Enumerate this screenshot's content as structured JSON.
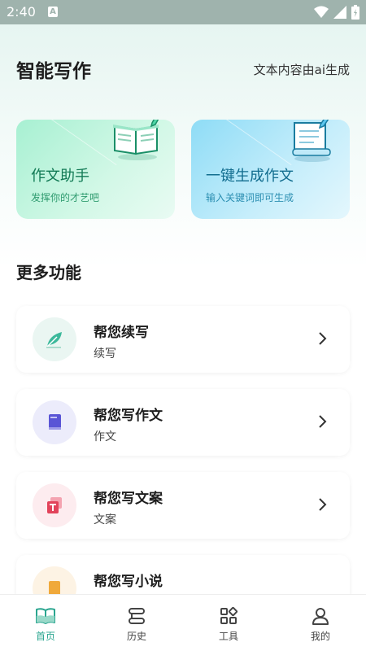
{
  "status": {
    "time": "2:40",
    "notification": "A"
  },
  "header": {
    "title": "智能写作",
    "ai_note": "文本内容由ai生成"
  },
  "cards": [
    {
      "title": "作文助手",
      "subtitle": "发挥你的才艺吧"
    },
    {
      "title": "一键生成作文",
      "subtitle": "输入关键词即可生成"
    }
  ],
  "section": {
    "title": "更多功能"
  },
  "features": [
    {
      "title": "帮您续写",
      "subtitle": "续写",
      "icon": "feather-icon",
      "color": "#3cb99b"
    },
    {
      "title": "帮您写作文",
      "subtitle": "作文",
      "icon": "book-icon",
      "color": "#5a55d6"
    },
    {
      "title": "帮您写文案",
      "subtitle": "文案",
      "icon": "text-doc-icon",
      "color": "#e2435b"
    },
    {
      "title": "帮您写小说",
      "subtitle": "",
      "icon": "novel-icon",
      "color": "#f0a93b"
    }
  ],
  "nav": [
    {
      "label": "首页",
      "icon": "book-open-icon",
      "active": true
    },
    {
      "label": "历史",
      "icon": "history-icon",
      "active": false
    },
    {
      "label": "工具",
      "icon": "tools-grid-icon",
      "active": false
    },
    {
      "label": "我的",
      "icon": "user-icon",
      "active": false
    }
  ],
  "colors": {
    "accent": "#2aa58f",
    "status_bar": "#9fb3ad"
  }
}
